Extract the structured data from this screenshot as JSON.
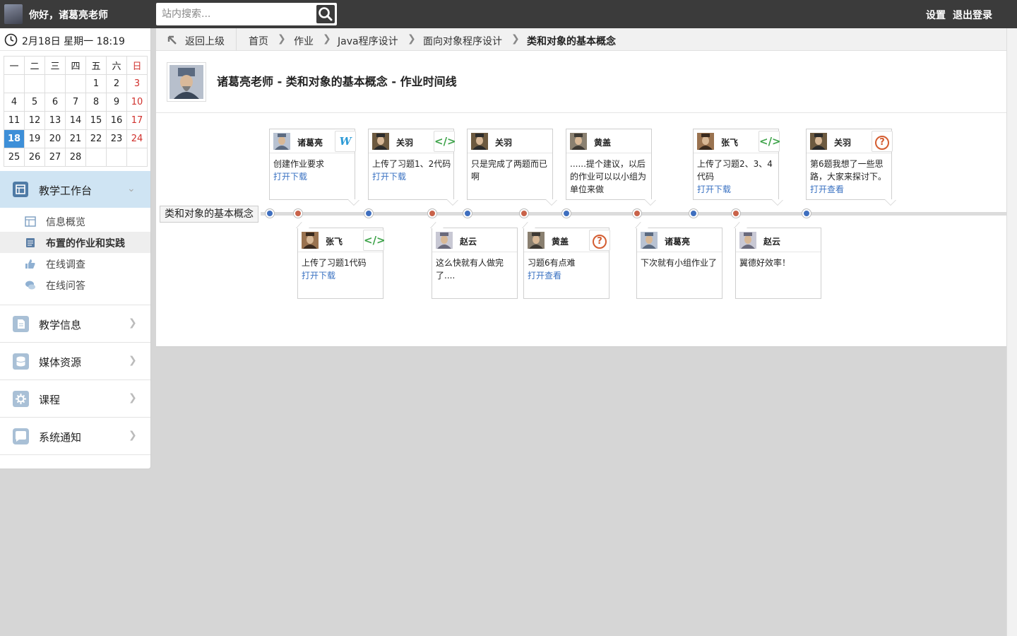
{
  "topbar": {
    "greeting": "你好，诸葛亮老师",
    "search_placeholder": "站内搜索...",
    "settings_label": "设置",
    "logout_label": "退出登录"
  },
  "sidebar": {
    "datetime": "2月18日 星期一 18:19",
    "calendar": {
      "weekdays": [
        "一",
        "二",
        "三",
        "四",
        "五",
        "六",
        "日"
      ],
      "weeks": [
        [
          "",
          "",
          "",
          "",
          "1",
          "2",
          "3"
        ],
        [
          "4",
          "5",
          "6",
          "7",
          "8",
          "9",
          "10"
        ],
        [
          "11",
          "12",
          "13",
          "14",
          "15",
          "16",
          "17"
        ],
        [
          "18",
          "19",
          "20",
          "21",
          "22",
          "23",
          "24"
        ],
        [
          "25",
          "26",
          "27",
          "28",
          "",
          "",
          ""
        ]
      ],
      "today": "18"
    },
    "active_menu": "教学工作台",
    "submenu": [
      {
        "label": "信息概览",
        "icon": "overview-icon"
      },
      {
        "label": "布置的作业和实践",
        "icon": "assignment-icon",
        "selected": true
      },
      {
        "label": "在线调查",
        "icon": "thumbs-up-icon"
      },
      {
        "label": "在线问答",
        "icon": "chat-bubbles-icon"
      }
    ],
    "menu": [
      {
        "label": "教学信息",
        "icon": "document-icon"
      },
      {
        "label": "媒体资源",
        "icon": "database-icon"
      },
      {
        "label": "课程",
        "icon": "gear-icon"
      },
      {
        "label": "系统通知",
        "icon": "message-icon"
      }
    ]
  },
  "breadcrumb": {
    "back": "返回上级",
    "items": [
      "首页",
      "作业",
      "Java程序设计",
      "面向对象程序设计",
      "类和对象的基本概念"
    ]
  },
  "page": {
    "title": "诸葛亮老师 - 类和对象的基本概念 - 作业时间线"
  },
  "timeline": {
    "label": "类和对象的基本概念",
    "dot_colors": [
      "blue",
      "red",
      "blue",
      "red",
      "blue",
      "red",
      "blue",
      "red",
      "blue",
      "red",
      "blue"
    ],
    "colors": {
      "blue": "#3f6fbf",
      "red": "#c9634a",
      "link": "#3a72c2"
    },
    "cards": [
      {
        "name": "诸葛亮",
        "badge": "word-icon",
        "text": "创建作业要求",
        "link": "打开下载",
        "position": "top"
      },
      {
        "name": "张飞",
        "badge": "code-icon",
        "text": "上传了习题1代码",
        "link": "打开下载",
        "position": "bottom"
      },
      {
        "name": "关羽",
        "badge": "code-icon",
        "text": "上传了习题1、2代码",
        "link": "打开下载",
        "position": "top"
      },
      {
        "name": "赵云",
        "badge": "",
        "text": "这么快就有人做完了....",
        "link": "",
        "position": "bottom"
      },
      {
        "name": "关羽",
        "badge": "",
        "text": "只是完成了两题而已啊",
        "link": "",
        "position": "top"
      },
      {
        "name": "黄盖",
        "badge": "question-icon",
        "text": "习题6有点难",
        "link": "打开查看",
        "position": "bottom"
      },
      {
        "name": "黄盖",
        "badge": "",
        "text": "......提个建议，以后的作业可以以小组为单位来做",
        "link": "",
        "position": "top"
      },
      {
        "name": "诸葛亮",
        "badge": "",
        "text": "下次就有小组作业了",
        "link": "",
        "position": "bottom"
      },
      {
        "name": "张飞",
        "badge": "code-icon",
        "text": "上传了习题2、3、4代码",
        "link": "打开下载",
        "position": "top"
      },
      {
        "name": "赵云",
        "badge": "",
        "text": "翼德好效率！",
        "link": "",
        "position": "bottom"
      },
      {
        "name": "关羽",
        "badge": "question-icon",
        "text": "第6题我想了一些思路，大家来探讨下。",
        "link": "打开查看",
        "position": "top"
      }
    ]
  }
}
